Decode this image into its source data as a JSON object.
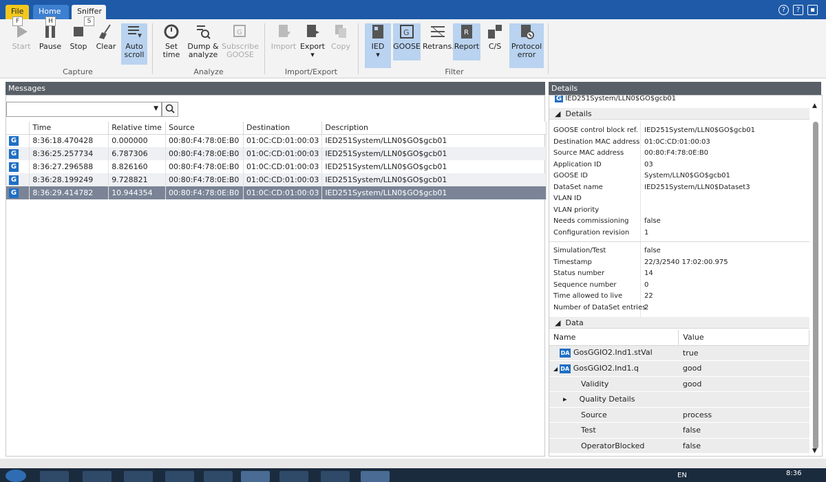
{
  "tabs": {
    "file": "File",
    "home": "Home",
    "sniffer": "Sniffer"
  },
  "keytips": {
    "file": "F",
    "home": "H",
    "sniffer": "S"
  },
  "ribbon": {
    "start": "Start",
    "pause": "Pause",
    "stop": "Stop",
    "clear": "Clear",
    "auto_scroll": [
      "Auto",
      "scroll"
    ],
    "set_time": [
      "Set",
      "time"
    ],
    "dump": [
      "Dump &",
      "analyze"
    ],
    "subscribe": [
      "Subscribe",
      "GOOSE"
    ],
    "import": "Import",
    "export": "Export",
    "copy": "Copy",
    "ied": "IED",
    "goose": "GOOSE",
    "retrans": "Retrans.",
    "report": "Report",
    "cs": "C/S",
    "protocol_error": [
      "Protocol",
      "error"
    ],
    "groups": {
      "capture": "Capture",
      "analyze": "Analyze",
      "import_export": "Import/Export",
      "filter": "Filter"
    }
  },
  "messages": {
    "title": "Messages",
    "columns": [
      "Time",
      "Relative time",
      "Source",
      "Destination",
      "Description"
    ],
    "rows": [
      [
        "8:36:18.470428",
        "0.000000",
        "00:80:F4:78:0E:B0",
        "01:0C:CD:01:00:03",
        "IED251System/LLN0$GO$gcb01"
      ],
      [
        "8:36:25.257734",
        "6.787306",
        "00:80:F4:78:0E:B0",
        "01:0C:CD:01:00:03",
        "IED251System/LLN0$GO$gcb01"
      ],
      [
        "8:36:27.296588",
        "8.826160",
        "00:80:F4:78:0E:B0",
        "01:0C:CD:01:00:03",
        "IED251System/LLN0$GO$gcb01"
      ],
      [
        "8:36:28.199249",
        "9.728821",
        "00:80:F4:78:0E:B0",
        "01:0C:CD:01:00:03",
        "IED251System/LLN0$GO$gcb01"
      ],
      [
        "8:36:29.414782",
        "10.944354",
        "00:80:F4:78:0E:B0",
        "01:0C:CD:01:00:03",
        "IED251System/LLN0$GO$gcb01"
      ]
    ],
    "row_icon": "G"
  },
  "details": {
    "title": "Details",
    "top_item": "IED251System/LLN0$GO$gcb01",
    "section_details": "Details",
    "fields1": [
      [
        "GOOSE control block ref.",
        "IED251System/LLN0$GO$gcb01"
      ],
      [
        "Destination MAC address",
        "01:0C:CD:01:00:03"
      ],
      [
        "Source MAC address",
        "00:80:F4:78:0E:B0"
      ],
      [
        "Application ID",
        "03"
      ],
      [
        "GOOSE ID",
        "System/LLN0$GO$gcb01"
      ],
      [
        "DataSet name",
        "IED251System/LLN0$Dataset3"
      ],
      [
        "VLAN ID",
        ""
      ],
      [
        "VLAN priority",
        ""
      ],
      [
        "Needs commissioning",
        "false"
      ],
      [
        "Configuration revision",
        "1"
      ]
    ],
    "fields2": [
      [
        "Simulation/Test",
        "false"
      ],
      [
        "Timestamp",
        "22/3/2540 17:02:00.975"
      ],
      [
        "Status number",
        "14"
      ],
      [
        "Sequence number",
        "0"
      ],
      [
        "Time allowed to live",
        "22"
      ],
      [
        "Number of DataSet entries",
        "2"
      ]
    ],
    "section_data": "Data",
    "data_columns": [
      "Name",
      "Value"
    ],
    "data_rows": [
      {
        "name": "GosGGIO2.Ind1.stVal",
        "value": "true"
      },
      {
        "name": "GosGGIO2.Ind1.q",
        "value": "good"
      },
      {
        "name": "Validity",
        "value": "good"
      },
      {
        "name": "Quality Details",
        "value": ""
      },
      {
        "name": "Source",
        "value": "process"
      },
      {
        "name": "Test",
        "value": "false"
      },
      {
        "name": "OperatorBlocked",
        "value": "false"
      }
    ],
    "da_icon": "DA"
  },
  "taskbar": {
    "lang": "EN",
    "clock": "8:36"
  },
  "colors": {
    "accent": "#1e5aa8",
    "selected_row": "#7a8496",
    "toggle_on": "#b9d3f0"
  }
}
